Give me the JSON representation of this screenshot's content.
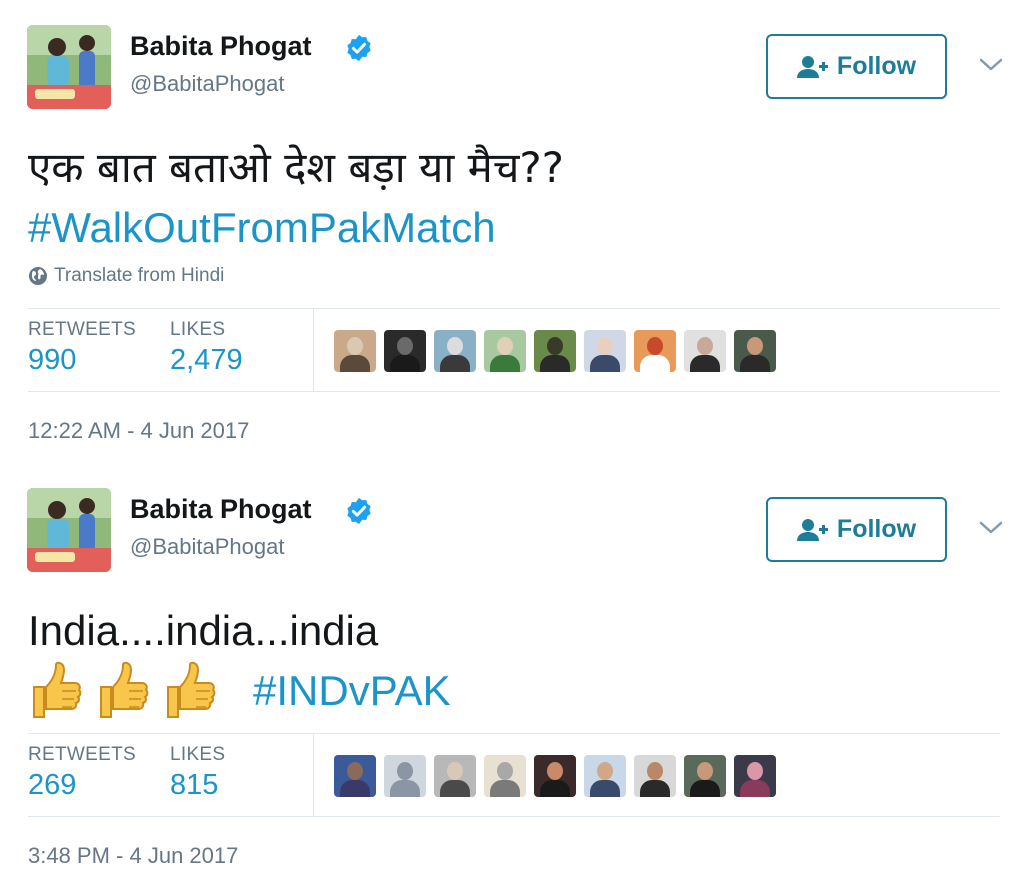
{
  "colors": {
    "link_blue": "#1b95c8",
    "follow_border": "#1d7c98",
    "verified_blue": "#1da1f2",
    "secondary_text": "#657786",
    "divider": "#e1e8ed"
  },
  "tweets": [
    {
      "author": {
        "name": "Babita Phogat",
        "handle": "@BabitaPhogat",
        "verified": true,
        "avatar_icon": "profile-photo"
      },
      "follow_label": "Follow",
      "text": "एक बात बताओ देश बड़ा या मैच??",
      "hashtag": "#WalkOutFromPakMatch",
      "translate_label": "Translate from Hindi",
      "retweets_label": "RETWEETS",
      "retweets": "990",
      "likes_label": "LIKES",
      "likes": "2,479",
      "likers_count": 9,
      "timestamp": "12:22 AM - 4 Jun 2017"
    },
    {
      "author": {
        "name": "Babita Phogat",
        "handle": "@BabitaPhogat",
        "verified": true,
        "avatar_icon": "profile-photo"
      },
      "follow_label": "Follow",
      "text": "India....india...india",
      "emoji": "👍👍👍",
      "hashtag": "#INDvPAK",
      "retweets_label": "RETWEETS",
      "retweets": "269",
      "likes_label": "LIKES",
      "likes": "815",
      "likers_count": 9,
      "timestamp": "3:48 PM - 4 Jun 2017"
    }
  ]
}
